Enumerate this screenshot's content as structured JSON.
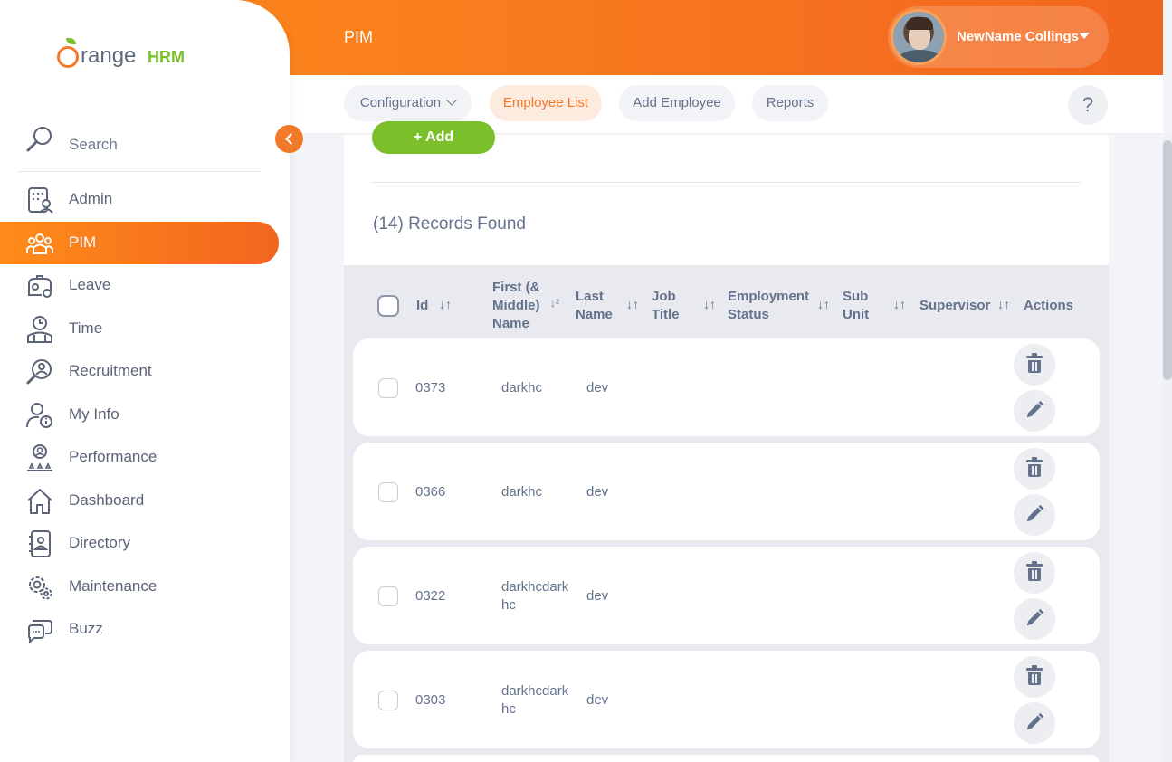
{
  "header": {
    "module_title": "PIM",
    "user_name": "NewName Collings"
  },
  "subnav": {
    "configuration": "Configuration",
    "employee_list": "Employee List",
    "add_employee": "Add Employee",
    "reports": "Reports",
    "help": "?"
  },
  "sidebar": {
    "logo_text": "range",
    "logo_hrm": "HRM",
    "search_label": "Search",
    "items": [
      {
        "label": "Admin",
        "icon": "admin-icon"
      },
      {
        "label": "PIM",
        "icon": "pim-icon",
        "active": true
      },
      {
        "label": "Leave",
        "icon": "leave-icon"
      },
      {
        "label": "Time",
        "icon": "time-icon"
      },
      {
        "label": "Recruitment",
        "icon": "recruitment-icon"
      },
      {
        "label": "My Info",
        "icon": "my-info-icon"
      },
      {
        "label": "Performance",
        "icon": "performance-icon"
      },
      {
        "label": "Dashboard",
        "icon": "dashboard-icon"
      },
      {
        "label": "Directory",
        "icon": "directory-icon"
      },
      {
        "label": "Maintenance",
        "icon": "maintenance-icon"
      },
      {
        "label": "Buzz",
        "icon": "buzz-icon"
      }
    ]
  },
  "main": {
    "add_button": "+ Add",
    "records_found": "(14) Records Found",
    "columns": {
      "id": "Id",
      "first_name_1": "First (&",
      "first_name_2": "Middle)",
      "first_name_3": "Name",
      "last_name_1": "Last",
      "last_name_2": "Name",
      "job_title_1": "Job",
      "job_title_2": "Title",
      "employment_status_1": "Employment",
      "employment_status_2": "Status",
      "sub_unit_1": "Sub",
      "sub_unit_2": "Unit",
      "supervisor": "Supervisor",
      "actions": "Actions"
    },
    "rows": [
      {
        "id": "0373",
        "first_1": "darkhc",
        "first_2": "",
        "last": "dev"
      },
      {
        "id": "0366",
        "first_1": "darkhc",
        "first_2": "",
        "last": "dev"
      },
      {
        "id": "0322",
        "first_1": "darkhcdark",
        "first_2": "hc",
        "last": "dev"
      },
      {
        "id": "0303",
        "first_1": "darkhcdark",
        "first_2": "hc",
        "last": "dev"
      }
    ]
  },
  "colors": {
    "accent_orange": "#f47a2a",
    "add_green": "#7bbf2a",
    "text_gray": "#64728c"
  }
}
